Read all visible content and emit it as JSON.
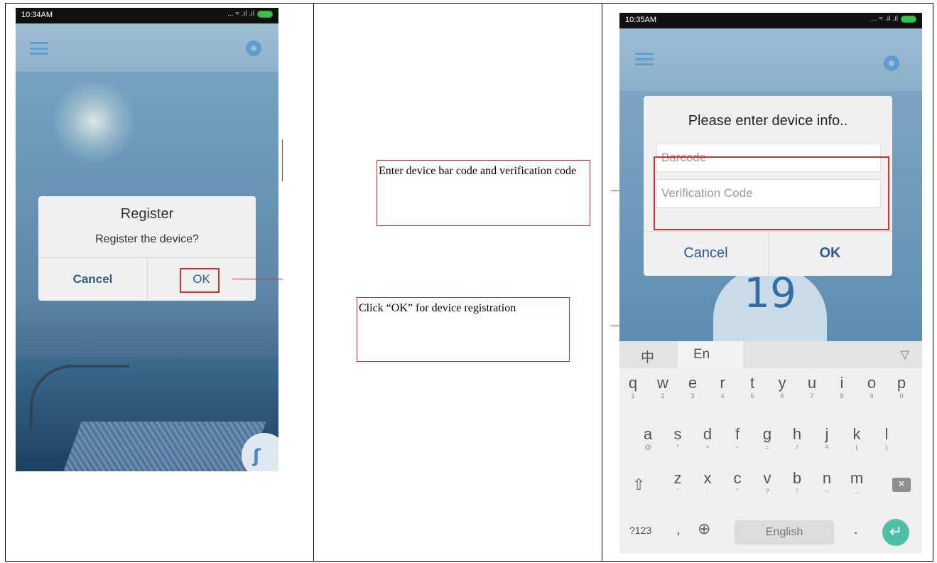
{
  "phone1": {
    "status_time": "10:34AM",
    "status_icons": "... ≈ .ıl .ıl",
    "register_dialog": {
      "title": "Register",
      "message": "Register the device?",
      "cancel_label": "Cancel",
      "ok_label": "OK"
    }
  },
  "annotations": {
    "enter_codes": "Enter device bar code and verification code",
    "click_ok": "Click “OK” for device registration"
  },
  "phone2": {
    "status_time": "10:35AM",
    "status_icons": "... ≈ .ıl .ıl",
    "gauge_value": "19",
    "device_dialog": {
      "title": "Please enter device info..",
      "barcode_placeholder": "Barcode",
      "verification_placeholder": "Verification Code",
      "cancel_label": "Cancel",
      "ok_label": "OK"
    },
    "keyboard": {
      "lang_cn": "中",
      "lang_en": "En",
      "collapse": "▽",
      "row1": [
        {
          "main": "q",
          "sub": "1"
        },
        {
          "main": "w",
          "sub": "2"
        },
        {
          "main": "e",
          "sub": "3"
        },
        {
          "main": "r",
          "sub": "4"
        },
        {
          "main": "t",
          "sub": "5"
        },
        {
          "main": "y",
          "sub": "6"
        },
        {
          "main": "u",
          "sub": "7"
        },
        {
          "main": "i",
          "sub": "8"
        },
        {
          "main": "o",
          "sub": "9"
        },
        {
          "main": "p",
          "sub": "0"
        }
      ],
      "row2": [
        {
          "main": "a",
          "sub": "@"
        },
        {
          "main": "s",
          "sub": "*"
        },
        {
          "main": "d",
          "sub": "+"
        },
        {
          "main": "f",
          "sub": "-"
        },
        {
          "main": "g",
          "sub": "="
        },
        {
          "main": "h",
          "sub": "/"
        },
        {
          "main": "j",
          "sub": "#"
        },
        {
          "main": "k",
          "sub": "("
        },
        {
          "main": "l",
          "sub": ")"
        }
      ],
      "row3": [
        {
          "main": "z",
          "sub": "'"
        },
        {
          "main": "x",
          "sub": ":"
        },
        {
          "main": "c",
          "sub": "\""
        },
        {
          "main": "v",
          "sub": "?"
        },
        {
          "main": "b",
          "sub": "!"
        },
        {
          "main": "n",
          "sub": "~"
        },
        {
          "main": "m",
          "sub": "…"
        }
      ],
      "key_123": "?123",
      "comma": ",",
      "space_label": "English",
      "period": "."
    }
  },
  "colors": {
    "highlight": "#d32f2f",
    "dialog_button_text": "#2d5a9a",
    "enter_key": "#4fc0a8"
  }
}
